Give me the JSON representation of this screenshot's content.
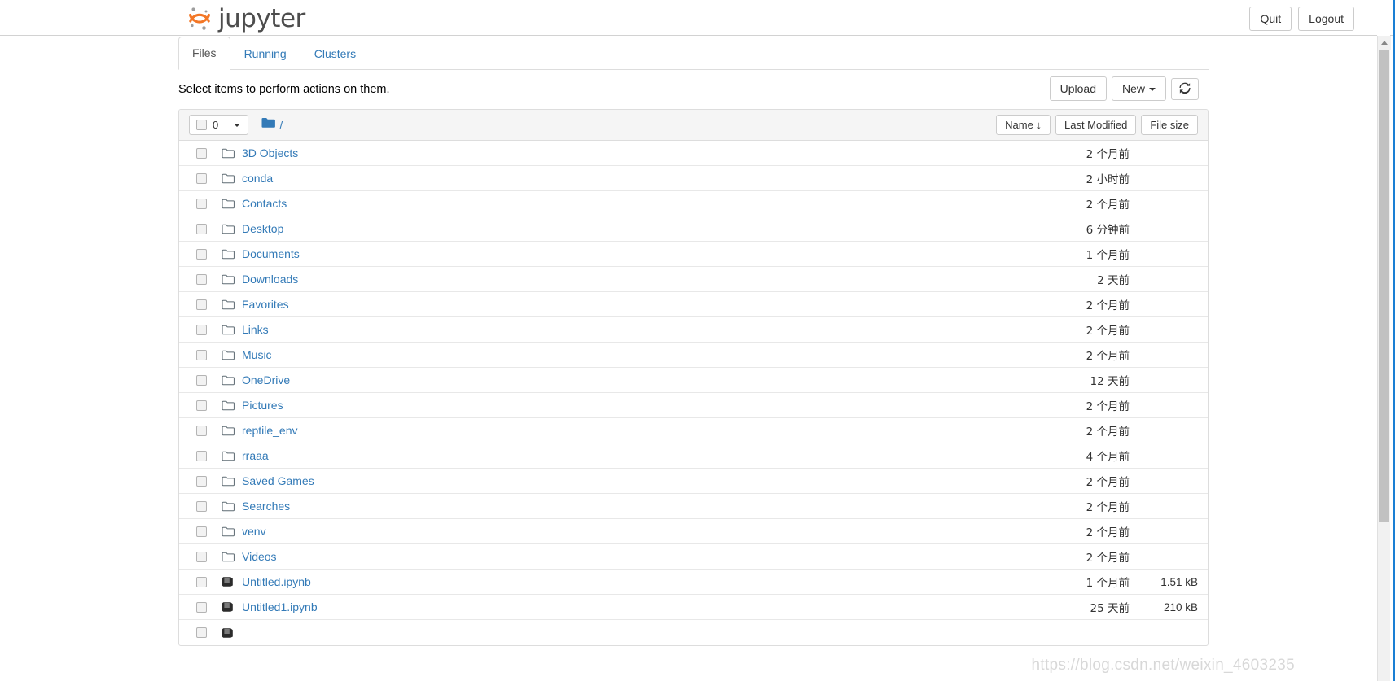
{
  "header": {
    "brand": "jupyter",
    "logo_color": "#f37726",
    "buttons": [
      {
        "label": "Quit",
        "name": "quit-button"
      },
      {
        "label": "Logout",
        "name": "logout-button"
      }
    ]
  },
  "tabs": [
    {
      "label": "Files",
      "active": true
    },
    {
      "label": "Running",
      "active": false
    },
    {
      "label": "Clusters",
      "active": false
    }
  ],
  "actionbar": {
    "instruction": "Select items to perform actions on them.",
    "upload_label": "Upload",
    "new_label": "New",
    "refresh_icon": "refresh-icon"
  },
  "listheader": {
    "selected_count": "0",
    "breadcrumb_root": "/",
    "folder_icon": "folder-filled-icon",
    "sort_name": "Name",
    "sort_name_arrow": "↓",
    "sort_modified": "Last Modified",
    "sort_size": "File size"
  },
  "accent_color": "#337ab7",
  "watermark": "https://blog.csdn.net/weixin_4603235",
  "files": [
    {
      "name": "3D Objects",
      "type": "folder",
      "modified": "2 个月前",
      "size": ""
    },
    {
      "name": "conda",
      "type": "folder",
      "modified": "2 小时前",
      "size": ""
    },
    {
      "name": "Contacts",
      "type": "folder",
      "modified": "2 个月前",
      "size": ""
    },
    {
      "name": "Desktop",
      "type": "folder",
      "modified": "6 分钟前",
      "size": ""
    },
    {
      "name": "Documents",
      "type": "folder",
      "modified": "1 个月前",
      "size": ""
    },
    {
      "name": "Downloads",
      "type": "folder",
      "modified": "2 天前",
      "size": ""
    },
    {
      "name": "Favorites",
      "type": "folder",
      "modified": "2 个月前",
      "size": ""
    },
    {
      "name": "Links",
      "type": "folder",
      "modified": "2 个月前",
      "size": ""
    },
    {
      "name": "Music",
      "type": "folder",
      "modified": "2 个月前",
      "size": ""
    },
    {
      "name": "OneDrive",
      "type": "folder",
      "modified": "12 天前",
      "size": ""
    },
    {
      "name": "Pictures",
      "type": "folder",
      "modified": "2 个月前",
      "size": ""
    },
    {
      "name": "reptile_env",
      "type": "folder",
      "modified": "2 个月前",
      "size": ""
    },
    {
      "name": "rraaa",
      "type": "folder",
      "modified": "4 个月前",
      "size": ""
    },
    {
      "name": "Saved Games",
      "type": "folder",
      "modified": "2 个月前",
      "size": ""
    },
    {
      "name": "Searches",
      "type": "folder",
      "modified": "2 个月前",
      "size": ""
    },
    {
      "name": "venv",
      "type": "folder",
      "modified": "2 个月前",
      "size": ""
    },
    {
      "name": "Videos",
      "type": "folder",
      "modified": "2 个月前",
      "size": ""
    },
    {
      "name": "Untitled.ipynb",
      "type": "notebook",
      "modified": "1 个月前",
      "size": "1.51 kB"
    },
    {
      "name": "Untitled1.ipynb",
      "type": "notebook",
      "modified": "25 天前",
      "size": "210 kB"
    },
    {
      "name": "",
      "type": "notebook",
      "modified": "",
      "size": ""
    }
  ]
}
